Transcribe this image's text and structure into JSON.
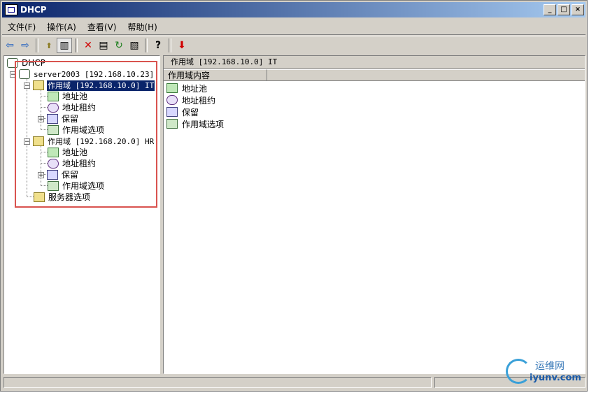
{
  "window": {
    "title": "DHCP",
    "buttons": {
      "minimize": "_",
      "maximize": "□",
      "close": "×"
    }
  },
  "menu": [
    {
      "label": "文件(F)"
    },
    {
      "label": "操作(A)"
    },
    {
      "label": "查看(V)"
    },
    {
      "label": "帮助(H)"
    }
  ],
  "toolbar": {
    "back": "⇦",
    "forward": "⇨",
    "up": "⬆",
    "show-hide": "▥",
    "delete": "✕",
    "properties": "▤",
    "refresh": "↻",
    "export": "▧",
    "help": "?",
    "stop": "⬇"
  },
  "tree": {
    "root": "DHCP",
    "server": "server2003 [192.168.10.23]",
    "scope1": "作用域 [192.168.10.0] IT",
    "scope1_children": [
      "地址池",
      "地址租约",
      "保留",
      "作用域选项"
    ],
    "scope2": "作用域 [192.168.20.0] HR",
    "scope2_children": [
      "地址池",
      "地址租约",
      "保留",
      "作用域选项"
    ],
    "server_options": "服务器选项"
  },
  "right": {
    "title": "作用域 [192.168.10.0] IT",
    "column": "作用域内容",
    "items": [
      "地址池",
      "地址租约",
      "保留",
      "作用域选项"
    ]
  },
  "watermark": {
    "top": "运维网",
    "bottom": "iyunv.com"
  }
}
